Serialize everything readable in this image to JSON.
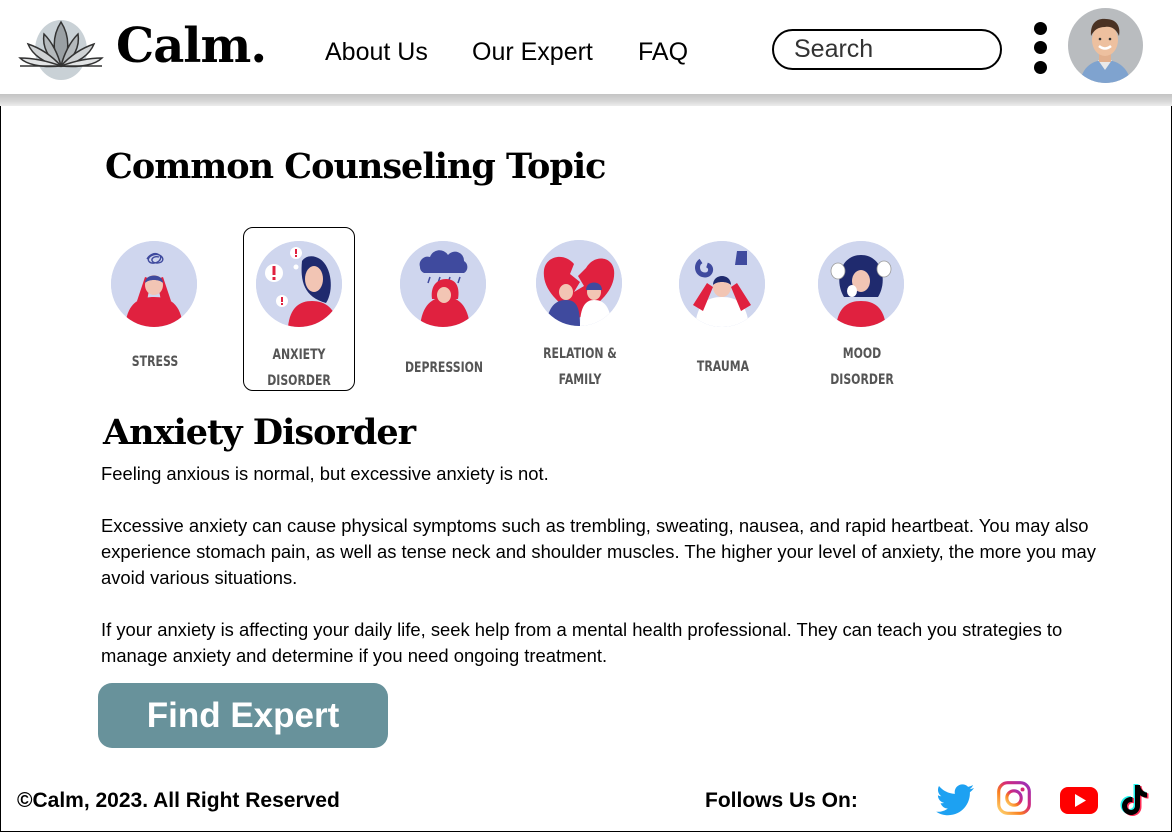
{
  "header": {
    "brand": "Calm.",
    "nav": {
      "about": "About Us",
      "expert": "Our Expert",
      "faq": "FAQ"
    },
    "search_placeholder": "Search"
  },
  "topics": {
    "title": "Common Counseling Topic",
    "items": [
      {
        "label": "STRESS"
      },
      {
        "label": "ANXIETY\nDISORDER",
        "selected": true
      },
      {
        "label": "DEPRESSION"
      },
      {
        "label": "RELATION &\nFAMILY"
      },
      {
        "label": "TRAUMA"
      },
      {
        "label": "MOOD\nDISORDER"
      }
    ]
  },
  "content": {
    "title": "Anxiety Disorder",
    "p1": "Feeling anxious is normal, but excessive anxiety is not.",
    "p2": "Excessive anxiety can cause physical symptoms such as trembling, sweating, nausea, and rapid heartbeat. You may also experience stomach pain, as well as tense neck and shoulder muscles. The higher your level of anxiety, the more you may avoid various situations.",
    "p3": "If your anxiety is affecting your daily life, seek help from a mental health professional. They can teach you strategies to manage anxiety and determine if you need ongoing treatment.",
    "button": "Find Expert"
  },
  "footer": {
    "copyright": "©Calm, 2023. All Right Reserved",
    "follow": "Follows Us On:",
    "socials": [
      "twitter-icon",
      "instagram-icon",
      "youtube-icon",
      "tiktok-icon"
    ]
  },
  "colors": {
    "accent": "#68929b",
    "topic_circle": "#cfd6ee",
    "illustration_red": "#e0213f",
    "illustration_navy": "#3f4a9e"
  }
}
